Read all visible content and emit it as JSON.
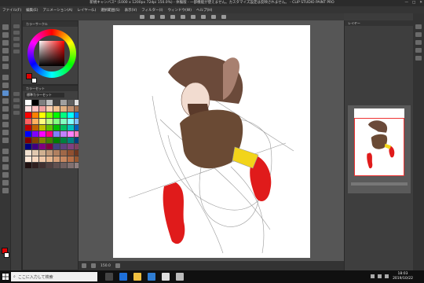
{
  "window": {
    "title": "新規キャンバス* (1000 x 1200px 72dpi 150.0%) - 体験版 - 一部機能が使えません。カスタマイズ設定は反映されません。 - CLIP STUDIO PAINT PRO",
    "controls": [
      "—",
      "□",
      "✕"
    ]
  },
  "menu": [
    "ファイル(F)",
    "編集(E)",
    "アニメーション(A)",
    "レイヤー(L)",
    "選択範囲(S)",
    "表示(V)",
    "フィルター(I)",
    "ウィンドウ(W)",
    "ヘルプ(H)"
  ],
  "panels": {
    "color_tab": "カラーサークル",
    "palette_tab": "カラーセット",
    "palette_title": "標準カラーセット",
    "layer_tab": "レイヤー"
  },
  "colors": {
    "main": "#e10000",
    "sub": "#ffffff"
  },
  "palette": [
    "#ffffff",
    "#000000",
    "#808080",
    "#c0c0c0",
    "#404040",
    "#a0a0a0",
    "#606060",
    "#e0e0e0",
    "#ffe0e0",
    "#ffc0c0",
    "#f0a0a0",
    "#ffd0b0",
    "#f0c090",
    "#e0b080",
    "#c09070",
    "#a07050",
    "#ff0000",
    "#ff8000",
    "#ffff00",
    "#80ff00",
    "#00ff00",
    "#00ff80",
    "#00ffff",
    "#0080ff",
    "#ff6060",
    "#ffb060",
    "#ffff80",
    "#c0ff80",
    "#80ff80",
    "#80ffc0",
    "#80ffff",
    "#80c0ff",
    "#c00000",
    "#c06000",
    "#c0c000",
    "#60c000",
    "#00c000",
    "#00c060",
    "#00c0c0",
    "#0060c0",
    "#0000ff",
    "#8000ff",
    "#ff00ff",
    "#ff0080",
    "#8080ff",
    "#c080ff",
    "#ff80ff",
    "#ff80c0",
    "#800000",
    "#804000",
    "#808000",
    "#408000",
    "#008000",
    "#008040",
    "#008080",
    "#004080",
    "#000080",
    "#400080",
    "#800080",
    "#800040",
    "#404080",
    "#604080",
    "#804080",
    "#804060",
    "#f0e0d0",
    "#e0c8b0",
    "#d0b090",
    "#c09878",
    "#b08060",
    "#a06848",
    "#905030",
    "#703820",
    "#ffe8d8",
    "#f8d8c0",
    "#f0c8a8",
    "#e8b890",
    "#d8a078",
    "#c88860",
    "#b87048",
    "#985830",
    "#201010",
    "#302020",
    "#403030",
    "#504040",
    "#605050",
    "#706060",
    "#807070",
    "#908080"
  ],
  "navigator": {
    "zoom": "150.0"
  },
  "status": {
    "zoom": "150.0"
  },
  "taskbar": {
    "search_placeholder": "ここに入力して検索",
    "time": "18:03",
    "date": "2019/10/22"
  }
}
